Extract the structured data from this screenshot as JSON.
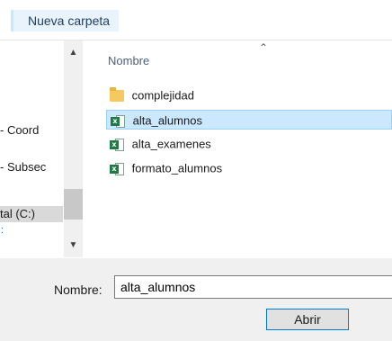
{
  "toolbar": {
    "new_folder_label": "Nueva carpeta"
  },
  "nav": {
    "items": [
      {
        "label": "- Coord",
        "selected": false
      },
      {
        "label": "- Subsec",
        "selected": false
      },
      {
        "label": "tal (C:)",
        "selected": true
      }
    ],
    "up_icon": "chevron-up-icon",
    "down_icon": "chevron-down-icon"
  },
  "files": {
    "column_header": "Nombre",
    "rows": [
      {
        "name": "complejidad",
        "icon": "folder-icon",
        "selected": false
      },
      {
        "name": "alta_alumnos",
        "icon": "excel-file-icon",
        "selected": true
      },
      {
        "name": "alta_examenes",
        "icon": "excel-file-icon",
        "selected": false
      },
      {
        "name": "formato_alumnos",
        "icon": "excel-file-icon",
        "selected": false
      }
    ]
  },
  "filename": {
    "label": "Nombre:",
    "value": "alta_alumnos"
  },
  "actions": {
    "open_label": "Abrir"
  },
  "colors": {
    "selection": "#cce8ff",
    "selection_border": "#99d1ff",
    "accent": "#0078d7"
  }
}
